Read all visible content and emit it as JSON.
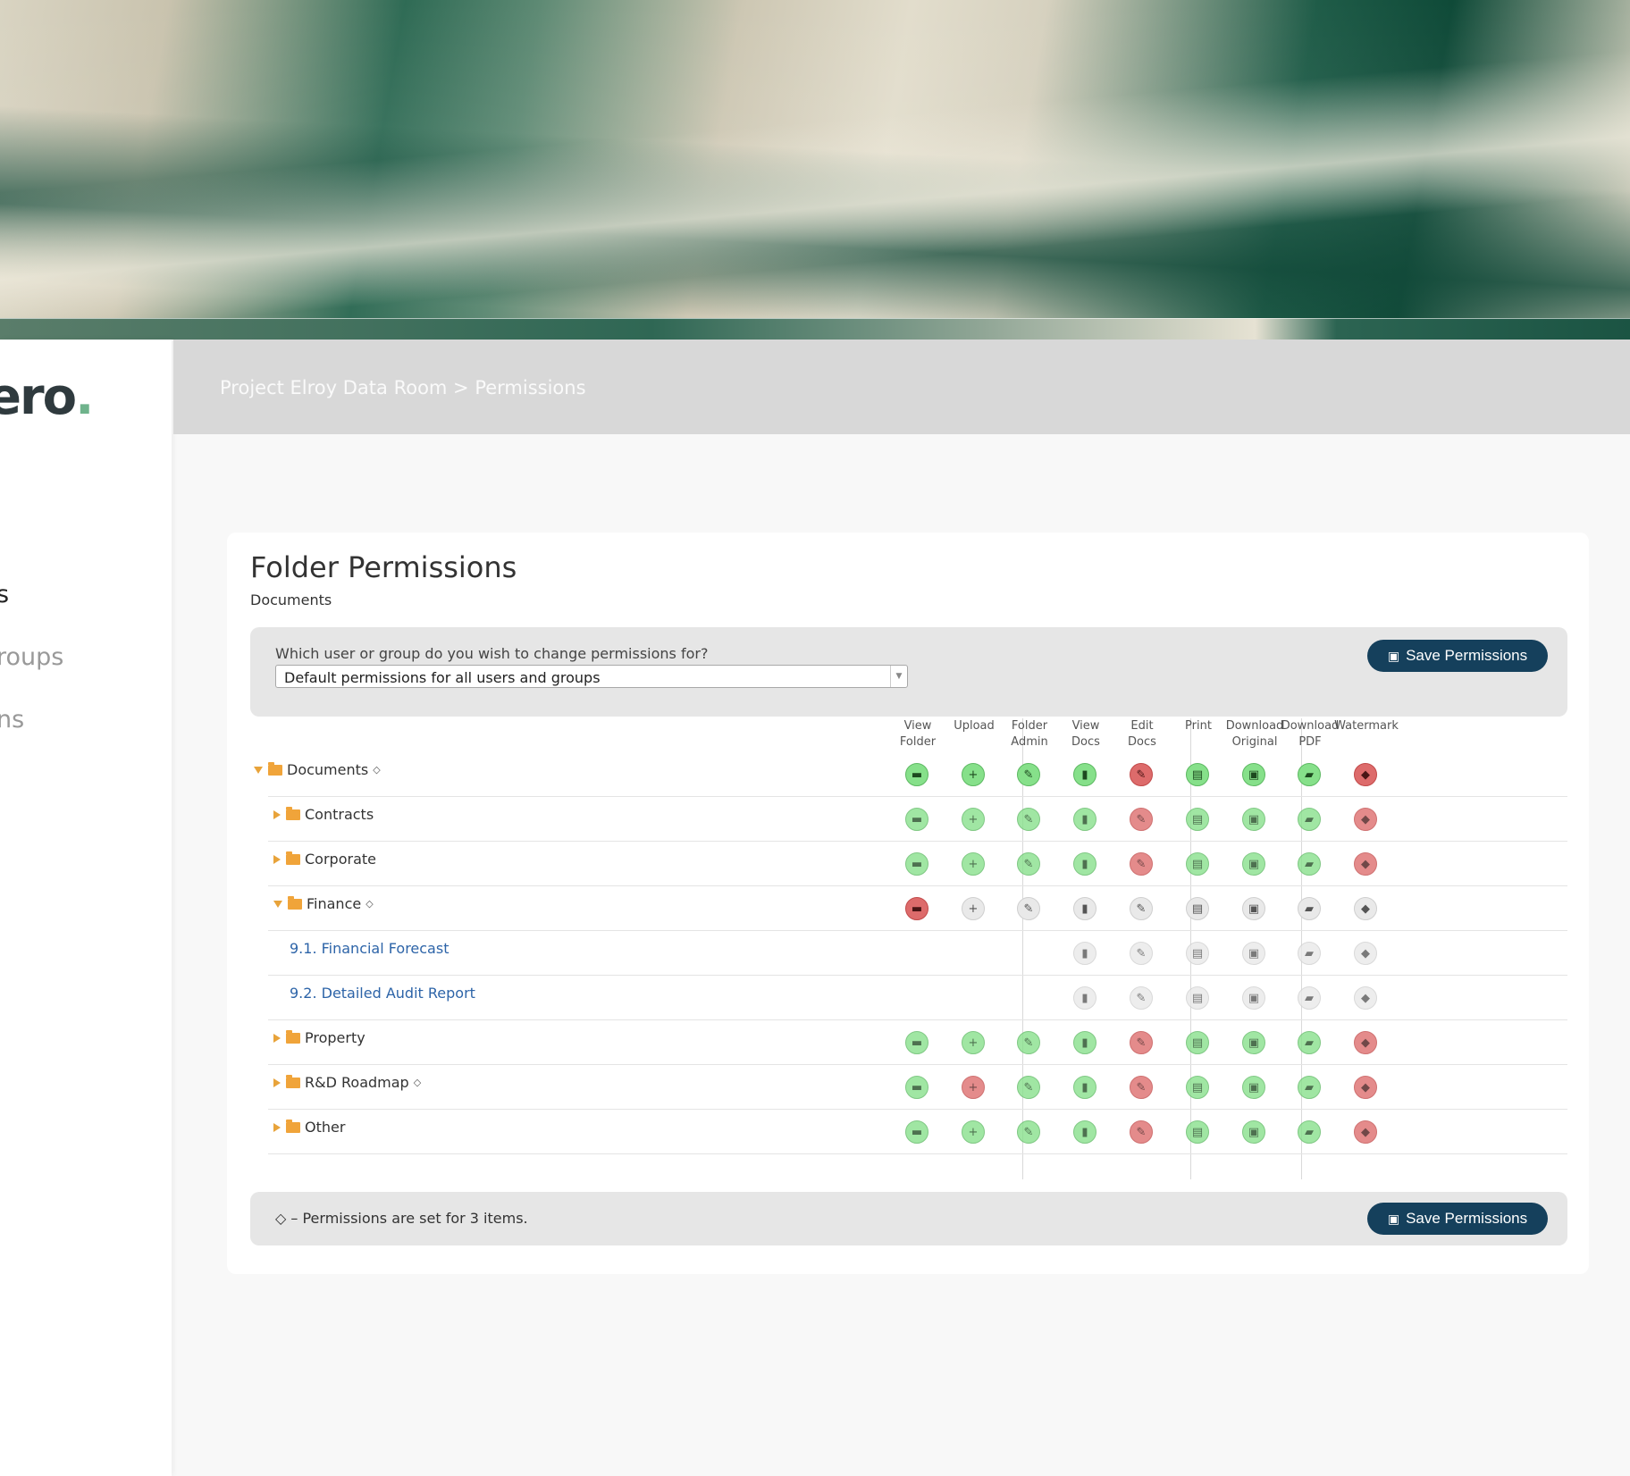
{
  "brand": {
    "logo_text": "ero",
    "logo_dot": "."
  },
  "sidebar": {
    "items": [
      {
        "label": "s",
        "active": true
      },
      {
        "label": "roups",
        "active": false
      },
      {
        "label": "ns",
        "active": false
      }
    ]
  },
  "header": {
    "breadcrumb": "Project Elroy Data Room > Permissions"
  },
  "card": {
    "title": "Folder Permissions",
    "subtitle": "Documents"
  },
  "selector": {
    "question": "Which user or group do you wish to change permissions for?",
    "selected": "Default permissions for all users and groups"
  },
  "save_label": "Save Permissions",
  "columns": [
    {
      "label": "View\nFolder",
      "icon": "folder-open-icon",
      "glyph": "▬"
    },
    {
      "label": "Upload",
      "icon": "plus-icon",
      "glyph": "+"
    },
    {
      "label": "Folder\nAdmin",
      "icon": "wrench-icon",
      "glyph": "✎"
    },
    {
      "label": "View\nDocs",
      "icon": "file-icon",
      "glyph": "▮"
    },
    {
      "label": "Edit\nDocs",
      "icon": "pencil-icon",
      "glyph": "✎"
    },
    {
      "label": "Print",
      "icon": "print-icon",
      "glyph": "▤"
    },
    {
      "label": "Download\nOriginal",
      "icon": "floppy-icon",
      "glyph": "▣"
    },
    {
      "label": "Download\nPDF",
      "icon": "pdf-icon",
      "glyph": "▰"
    },
    {
      "label": "Watermark",
      "icon": "tag-icon",
      "glyph": "◆"
    }
  ],
  "rows": [
    {
      "label": "Documents",
      "type": "folder",
      "expanded": true,
      "level": 0,
      "custom": true,
      "perms": [
        "green",
        "green",
        "green",
        "green",
        "red",
        "green",
        "green",
        "green",
        "red"
      ],
      "strong": true
    },
    {
      "label": "Contracts",
      "type": "folder",
      "expanded": false,
      "level": 1,
      "custom": false,
      "perms": [
        "green",
        "green",
        "green",
        "green",
        "red",
        "green",
        "green",
        "green",
        "red"
      ],
      "strong": false
    },
    {
      "label": "Corporate",
      "type": "folder",
      "expanded": false,
      "level": 1,
      "custom": false,
      "perms": [
        "green",
        "green",
        "green",
        "green",
        "red",
        "green",
        "green",
        "green",
        "red"
      ],
      "strong": false
    },
    {
      "label": "Finance",
      "type": "folder",
      "expanded": true,
      "level": 1,
      "custom": true,
      "perms": [
        "red",
        "gray",
        "gray",
        "gray",
        "gray",
        "gray",
        "gray",
        "gray",
        "gray"
      ],
      "strong": true
    },
    {
      "label": "9.1. Financial Forecast",
      "type": "doc",
      "level": 2,
      "custom": false,
      "perms": [
        "",
        "",
        "",
        "gray",
        "gray",
        "gray",
        "gray",
        "gray",
        "gray"
      ],
      "strong": false
    },
    {
      "label": "9.2. Detailed Audit Report",
      "type": "doc",
      "level": 2,
      "custom": false,
      "perms": [
        "",
        "",
        "",
        "gray",
        "gray",
        "gray",
        "gray",
        "gray",
        "gray"
      ],
      "strong": false
    },
    {
      "label": "Property",
      "type": "folder",
      "expanded": false,
      "level": 1,
      "custom": false,
      "perms": [
        "green",
        "green",
        "green",
        "green",
        "red",
        "green",
        "green",
        "green",
        "red"
      ],
      "strong": false
    },
    {
      "label": "R&D Roadmap",
      "type": "folder",
      "expanded": false,
      "level": 1,
      "custom": true,
      "perms": [
        "green",
        "red",
        "green",
        "green",
        "red",
        "green",
        "green",
        "green",
        "red"
      ],
      "strong": false
    },
    {
      "label": "Other",
      "type": "folder",
      "expanded": false,
      "level": 1,
      "custom": false,
      "perms": [
        "green",
        "green",
        "green",
        "green",
        "red",
        "green",
        "green",
        "green",
        "red"
      ],
      "strong": false
    }
  ],
  "footer": {
    "note": "◇ – Permissions are set for 3 items."
  }
}
